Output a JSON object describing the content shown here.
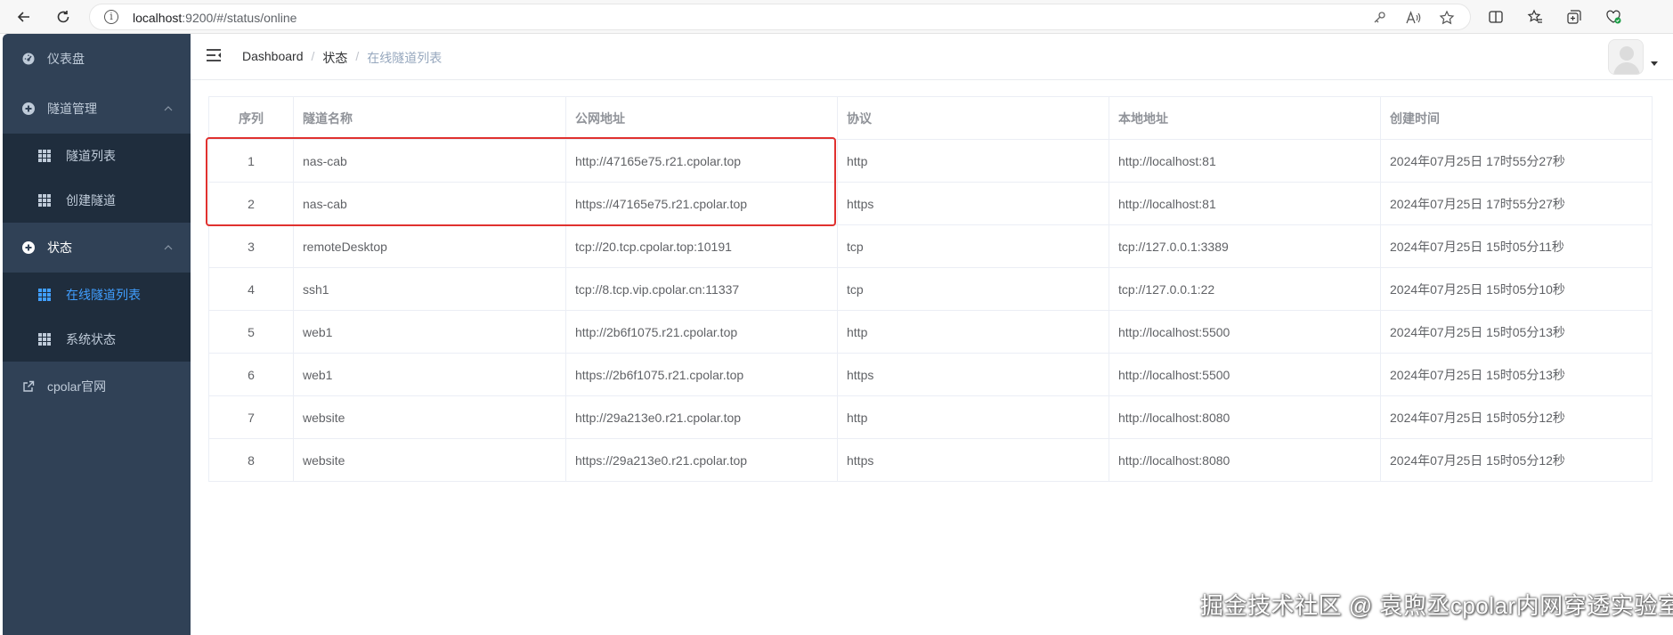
{
  "browser": {
    "url_host": "localhost",
    "url_rest": ":9200/#/status/online"
  },
  "sidebar": {
    "items": [
      {
        "label": "仪表盘",
        "icon": "dashboard-icon"
      },
      {
        "label": "隧道管理",
        "icon": "circle-plus-icon",
        "children": [
          {
            "label": "隧道列表",
            "icon": "grid-icon"
          },
          {
            "label": "创建隧道",
            "icon": "grid-icon"
          }
        ]
      },
      {
        "label": "状态",
        "icon": "circle-plus-icon",
        "children": [
          {
            "label": "在线隧道列表",
            "icon": "grid-icon",
            "active": true
          },
          {
            "label": "系统状态",
            "icon": "grid-icon"
          }
        ]
      },
      {
        "label": "cpolar官网",
        "icon": "external-link-icon"
      }
    ]
  },
  "breadcrumb": [
    "Dashboard",
    "状态",
    "在线隧道列表"
  ],
  "table": {
    "columns": [
      "序列",
      "隧道名称",
      "公网地址",
      "协议",
      "本地地址",
      "创建时间"
    ],
    "rows": [
      [
        "1",
        "nas-cab",
        "http://47165e75.r21.cpolar.top",
        "http",
        "http://localhost:81",
        "2024年07月25日 17时55分27秒"
      ],
      [
        "2",
        "nas-cab",
        "https://47165e75.r21.cpolar.top",
        "https",
        "http://localhost:81",
        "2024年07月25日 17时55分27秒"
      ],
      [
        "3",
        "remoteDesktop",
        "tcp://20.tcp.cpolar.top:10191",
        "tcp",
        "tcp://127.0.0.1:3389",
        "2024年07月25日 15时05分11秒"
      ],
      [
        "4",
        "ssh1",
        "tcp://8.tcp.vip.cpolar.cn:11337",
        "tcp",
        "tcp://127.0.0.1:22",
        "2024年07月25日 15时05分10秒"
      ],
      [
        "5",
        "web1",
        "http://2b6f1075.r21.cpolar.top",
        "http",
        "http://localhost:5500",
        "2024年07月25日 15时05分13秒"
      ],
      [
        "6",
        "web1",
        "https://2b6f1075.r21.cpolar.top",
        "https",
        "http://localhost:5500",
        "2024年07月25日 15时05分13秒"
      ],
      [
        "7",
        "website",
        "http://29a213e0.r21.cpolar.top",
        "http",
        "http://localhost:8080",
        "2024年07月25日 15时05分12秒"
      ],
      [
        "8",
        "website",
        "https://29a213e0.r21.cpolar.top",
        "https",
        "http://localhost:8080",
        "2024年07月25日 15时05分12秒"
      ]
    ]
  },
  "watermark": "掘金技术社区 @ 袁煦丞cpolar内网穿透实验室",
  "colors": {
    "sidebar_bg": "#304156",
    "submenu_bg": "#1f2d3d",
    "active": "#409eff",
    "highlight": "#e0312f"
  }
}
